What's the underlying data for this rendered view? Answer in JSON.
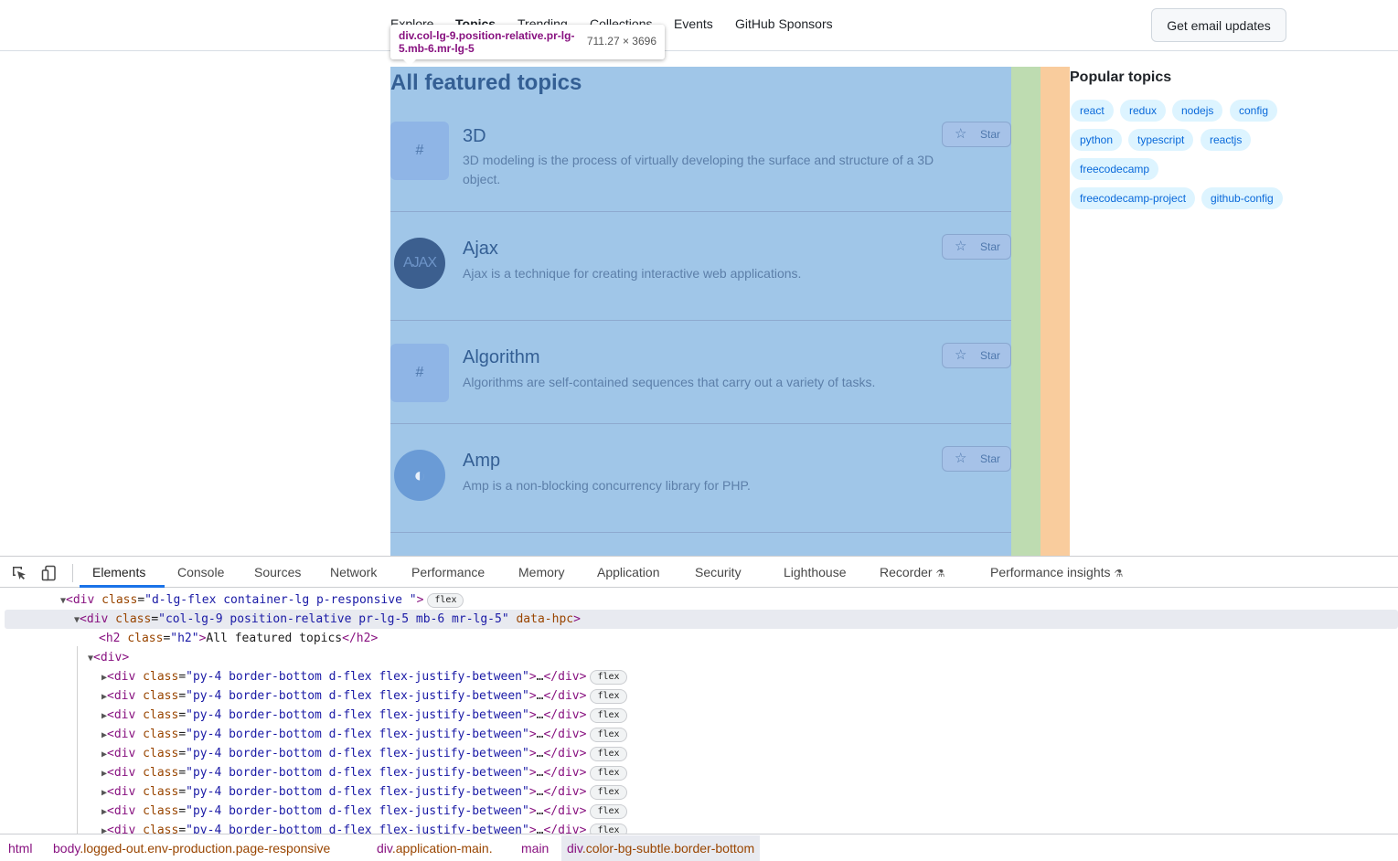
{
  "page": {
    "nav": [
      "Explore",
      "Topics",
      "Trending",
      "Collections",
      "Events",
      "GitHub Sponsors"
    ],
    "email_button": "Get email updates",
    "heading": "All featured topics",
    "tooltip": {
      "selector": "div.col-lg-9.position-relative.pr-lg-5.mb-6.mr-lg-5",
      "size": "711.27 × 3696"
    },
    "topics": [
      {
        "title": "3D",
        "desc": "3D modeling is the process of virtually developing the surface and structure of a 3D object.",
        "logo": "#",
        "star": "Star"
      },
      {
        "title": "Ajax",
        "desc": "Ajax is a technique for creating interactive web applications.",
        "logo": "AJAX",
        "star": "Star"
      },
      {
        "title": "Algorithm",
        "desc": "Algorithms are self-contained sequences that carry out a variety of tasks.",
        "logo": "#",
        "star": "Star"
      },
      {
        "title": "Amp",
        "desc": "Amp is a non-blocking concurrency library for PHP.",
        "logo": "",
        "star": "Star"
      }
    ],
    "popular_title": "Popular topics",
    "popular_tags": [
      "react",
      "redux",
      "nodejs",
      "config",
      "python",
      "typescript",
      "reactjs",
      "freecodecamp",
      "freecodecamp-project",
      "github-config"
    ]
  },
  "devtools": {
    "tabs": [
      "Elements",
      "Console",
      "Sources",
      "Network",
      "Performance",
      "Memory",
      "Application",
      "Security",
      "Lighthouse",
      "Recorder",
      "Performance insights"
    ],
    "active_tab": "Elements",
    "dom": {
      "container_tag": "div",
      "container_class": "d-lg-flex container-lg p-responsive ",
      "flex_badge": "flex",
      "selected_tag": "div",
      "selected_class": "col-lg-9 position-relative pr-lg-5 mb-6 mr-lg-5",
      "selected_extra_attr": "data-hpc",
      "h2_tag": "h2",
      "h2_class": "h2",
      "h2_text": "All featured topics",
      "inner_div_tag": "div",
      "row_class": "py-4 border-bottom d-flex flex-justify-between",
      "ellipsis": "…"
    },
    "breadcrumbs": [
      {
        "tag": "html",
        "cls": ""
      },
      {
        "tag": "body",
        "cls": ".logged-out.env-production.page-responsive"
      },
      {
        "tag": "div",
        "cls": ".application-main."
      },
      {
        "tag": "main",
        "cls": ""
      },
      {
        "tag": "div",
        "cls": ".color-bg-subtle.border-bottom"
      }
    ]
  }
}
